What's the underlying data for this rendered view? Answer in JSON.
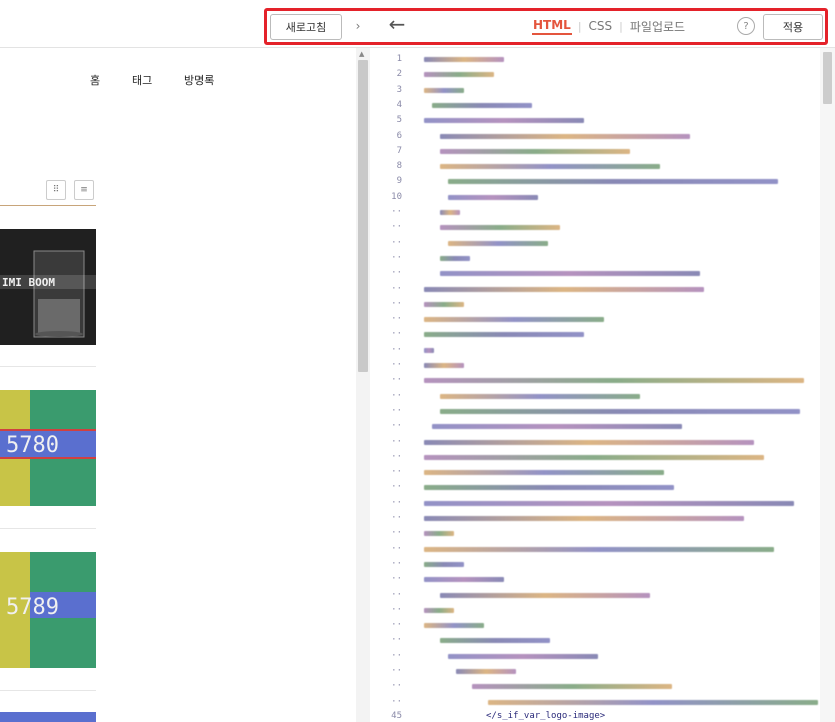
{
  "left_toolbar": {
    "refresh_label": "새로고침",
    "collapse_glyph": "›"
  },
  "blog_nav": {
    "items": [
      "홈",
      "태그",
      "방명록"
    ]
  },
  "view_toggles": {
    "grid_glyph": "⠿",
    "list_glyph": "≡"
  },
  "thumbnails": [
    {
      "text": "IMI BOOM",
      "bg": "#1c1c1c"
    },
    {
      "text": "5780",
      "bg": "#3a9b6e"
    },
    {
      "text": "5789",
      "bg": "#3a9b6e"
    },
    {
      "text": "",
      "bg": "#5a6fcf"
    }
  ],
  "editor_toolbar": {
    "back_glyph": "←",
    "tabs": [
      {
        "label": "HTML",
        "active": true
      },
      {
        "label": "CSS",
        "active": false
      },
      {
        "label": "파일업로드",
        "active": false
      }
    ],
    "help_glyph": "?",
    "apply_label": "적용"
  },
  "code": {
    "last_line_number": "45",
    "last_line_text": "</s_if_var_logo-image>"
  },
  "colors": {
    "accent": "#e4553d",
    "highlight_border": "#e4222a"
  }
}
